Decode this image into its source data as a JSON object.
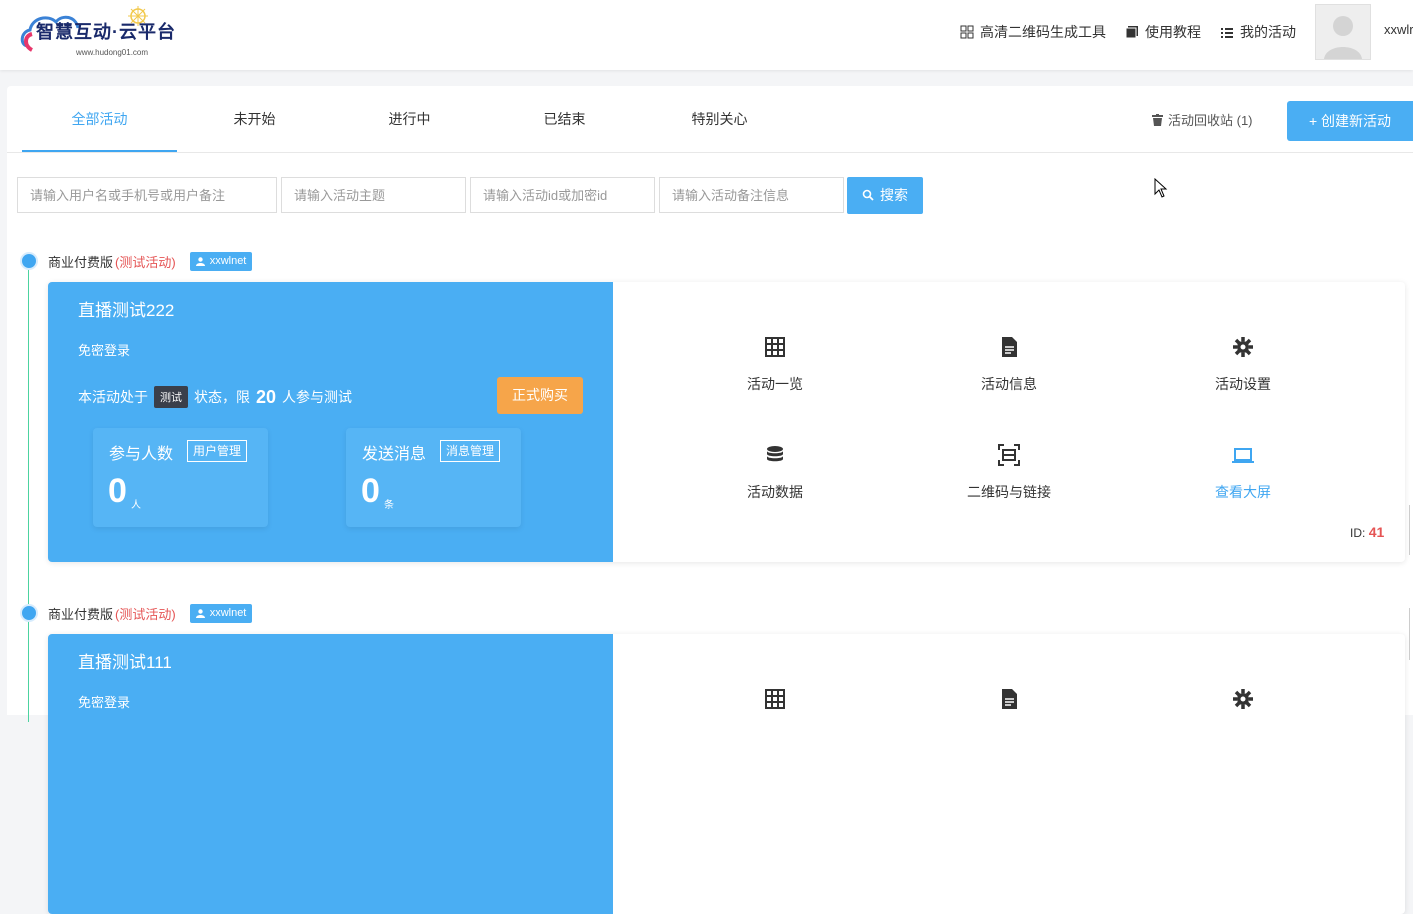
{
  "header": {
    "logo_text": "智慧互动·云平台",
    "logo_sub": "www.hudong01.com",
    "nav": [
      {
        "label": "高清二维码生成工具",
        "icon": "grid-icon"
      },
      {
        "label": "使用教程",
        "icon": "book-icon"
      },
      {
        "label": "我的活动",
        "icon": "list-icon"
      }
    ],
    "username": "xxwlr"
  },
  "tabs": [
    {
      "label": "全部活动",
      "active": true
    },
    {
      "label": "未开始",
      "active": false
    },
    {
      "label": "进行中",
      "active": false
    },
    {
      "label": "已结束",
      "active": false
    },
    {
      "label": "特别关心",
      "active": false
    }
  ],
  "recycle_label": "活动回收站 (1)",
  "create_label": "+ 创建新活动",
  "search": {
    "user_placeholder": "请输入用户名或手机号或用户备注",
    "topic_placeholder": "请输入活动主题",
    "id_placeholder": "请输入活动id或加密id",
    "note_placeholder": "请输入活动备注信息",
    "button_label": "搜索"
  },
  "activities": [
    {
      "edition": "商业付费版",
      "test_tag": "(测试活动)",
      "user": "xxwlnet",
      "title": "直播测试222",
      "login_type": "免密登录",
      "status_prefix": "本活动处于",
      "status_badge": "测试",
      "status_mid": "状态，限",
      "limit": "20",
      "status_suffix": "人参与测试",
      "buy_label": "正式购买",
      "participants_label": "参与人数",
      "participants_button": "用户管理",
      "participants_value": "0",
      "participants_unit": "人",
      "messages_label": "发送消息",
      "messages_button": "消息管理",
      "messages_value": "0",
      "messages_unit": "条",
      "menu": [
        "活动一览",
        "活动信息",
        "活动设置",
        "活动数据",
        "二维码与链接",
        "查看大屏"
      ],
      "id_label": "ID:",
      "id_value": "41"
    },
    {
      "edition": "商业付费版",
      "test_tag": "(测试活动)",
      "user": "xxwlnet",
      "title": "直播测试111",
      "login_type": "免密登录"
    }
  ],
  "colors": {
    "primary": "#4aaef3",
    "orange": "#f6a54a",
    "red": "#e55454",
    "timeline": "#4cd3a0"
  }
}
